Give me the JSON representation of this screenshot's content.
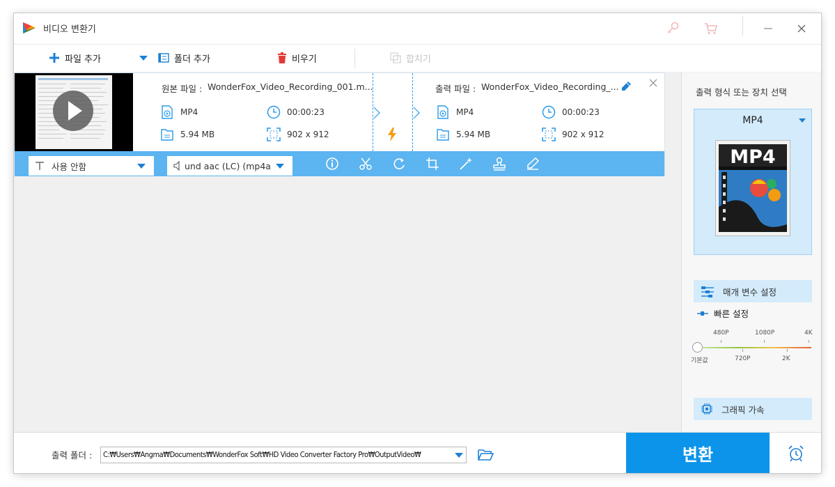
{
  "window": {
    "title": "비디오 변환기"
  },
  "toolbar": {
    "add_file": "파일 추가",
    "add_folder": "폴더 추가",
    "clear": "비우기",
    "merge": "합치기"
  },
  "file": {
    "source_label": "원본 파일 :",
    "source_name": "WonderFox_Video_Recording_001.m...",
    "output_label": "출력 파일 :",
    "output_name": "WonderFox_Video_Recording_...",
    "source": {
      "format": "MP4",
      "duration": "00:00:23",
      "size": "5.94 MB",
      "resolution": "902 x 912"
    },
    "output": {
      "format": "MP4",
      "duration": "00:00:23",
      "size": "5.94 MB",
      "resolution": "902 x 912"
    },
    "subtitle": "사용 안함",
    "audio_track": "und aac (LC) (mp4a"
  },
  "right_panel": {
    "title": "출력 형식 또는 장치 선택",
    "format": "MP4",
    "format_image_text": "MP4",
    "params_button": "매개 변수 설정",
    "quick_title": "빠른 설정",
    "quality_top": [
      "480P",
      "1080P",
      "4K"
    ],
    "quality_bottom": [
      "기본값",
      "720P",
      "2K"
    ],
    "quality_level": 0,
    "gpu_button": "그래픽 가속"
  },
  "bottom": {
    "output_label": "출력 폴더 :",
    "output_path": "C:₩Users₩Angma₩Documents₩WonderFox Soft₩HD Video Converter Factory Pro₩OutputVideo₩",
    "convert": "변환"
  },
  "colors": {
    "accent": "#0c94ea",
    "bar": "#5cb4f0",
    "panel": "#d4ebfb",
    "flash": "#f39c12",
    "clear_icon": "#e53935"
  }
}
